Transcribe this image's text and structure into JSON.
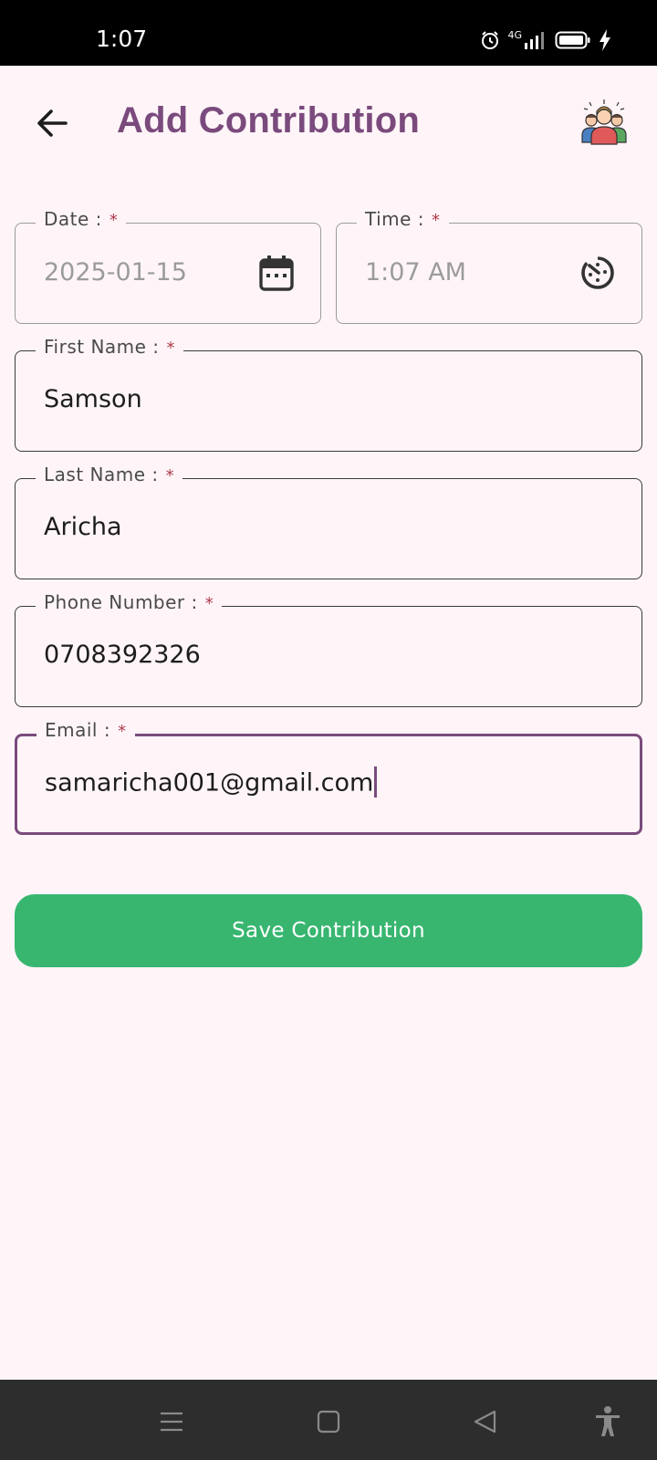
{
  "status_bar": {
    "time": "1:07",
    "network": "4G",
    "icons": [
      "alarm-icon",
      "signal-icon",
      "battery-icon",
      "charging-icon"
    ]
  },
  "app_bar": {
    "title": "Add Contribution",
    "back_icon": "arrow-left-icon",
    "action_icon": "people-group-icon"
  },
  "form": {
    "date": {
      "label": "Date :",
      "required": "*",
      "value": "2025-01-15",
      "icon": "calendar-icon"
    },
    "time": {
      "label": "Time :",
      "required": "*",
      "value": "1:07 AM",
      "icon": "timer-icon"
    },
    "first_name": {
      "label": "First Name :",
      "required": "*",
      "value": "Samson"
    },
    "last_name": {
      "label": "Last Name :",
      "required": "*",
      "value": "Aricha"
    },
    "phone": {
      "label": "Phone Number :",
      "required": "*",
      "value": "0708392326"
    },
    "email": {
      "label": "Email :",
      "required": "*",
      "value": "samaricha001@gmail.com"
    }
  },
  "save_button": {
    "label": "Save Contribution"
  },
  "nav_bar": {
    "icons": [
      "menu-icon",
      "home-square-icon",
      "back-triangle-icon",
      "accessibility-icon"
    ]
  },
  "colors": {
    "background": "#fff5f8",
    "accent": "#7a4a7d",
    "button": "#38b670",
    "required": "#b03a4a"
  }
}
